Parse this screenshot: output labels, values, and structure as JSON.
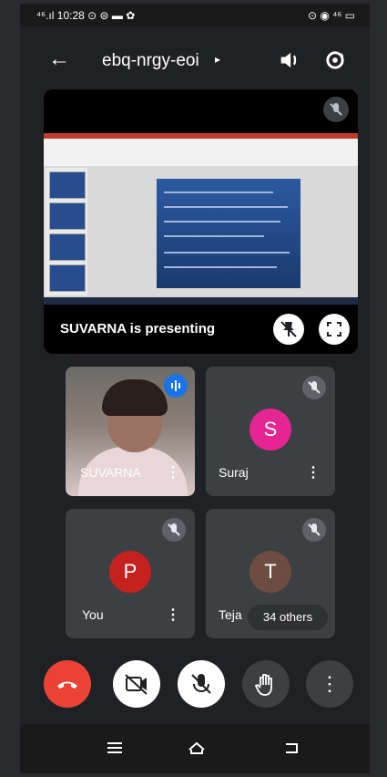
{
  "status_bar": {
    "left": "⁴⁶.ıl 10:28 ⊙ ⊜ ▬ ✿",
    "right": "⊙ ◉ ⁴⁶ ▭"
  },
  "header": {
    "meeting_code": "ebq-nrgy-eoi",
    "title_chevron": "▸",
    "back_icon": "←"
  },
  "presentation": {
    "label": "SUVARNA is presenting"
  },
  "participants": [
    {
      "name": "SUVARNA",
      "menu": "⋮"
    },
    {
      "name": "Suraj",
      "avatar_letter": "S",
      "avatar_color": "#e52592",
      "menu": "⋮"
    },
    {
      "name": "You",
      "avatar_letter": "P",
      "avatar_color": "#c5221f",
      "menu": "⋮"
    },
    {
      "name": "Teja",
      "avatar_letter": "T",
      "avatar_color": "#6d4c41"
    }
  ],
  "others_chip": "34 others",
  "controls": {
    "end_call_color": "#ea4335"
  },
  "more_options_icon": "⋮"
}
